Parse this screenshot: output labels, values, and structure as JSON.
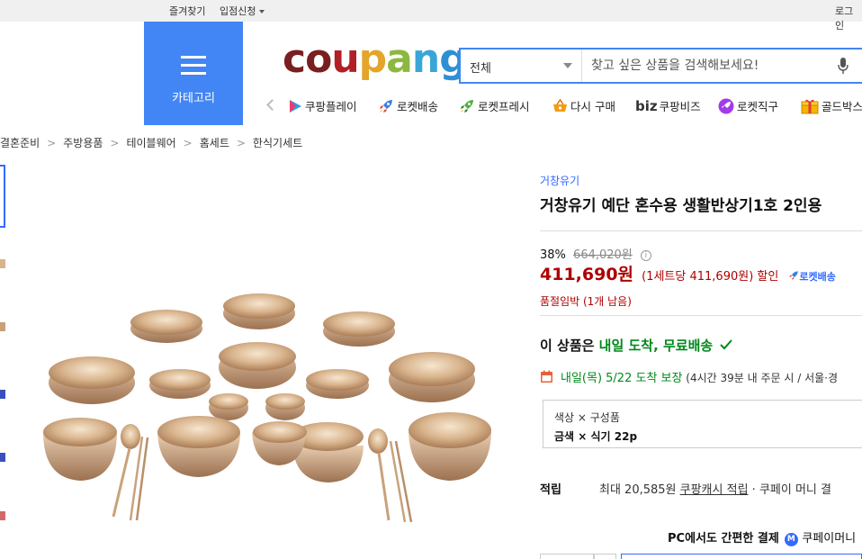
{
  "topbar": {
    "favorites": "즐겨찾기",
    "seller_apply": "입점신청",
    "login": "로그인"
  },
  "category_button": {
    "label": "카테고리"
  },
  "logo": {
    "text": "coupang",
    "colors": [
      "#7a1f1f",
      "#7a1f1f",
      "#b21f24",
      "#e4a52b",
      "#8cb83f",
      "#3aa6d8",
      "#2f8fd3"
    ]
  },
  "search": {
    "category_selected": "전체",
    "placeholder": "찾고 싶은 상품을 검색해보세요!"
  },
  "quick_links": [
    {
      "label": "쿠팡플레이",
      "icon": "play-icon"
    },
    {
      "label": "로켓배송",
      "icon": "rocket-icon"
    },
    {
      "label": "로켓프레시",
      "icon": "rocket-fresh-icon"
    },
    {
      "label": "다시 구매",
      "icon": "basket-icon"
    },
    {
      "label": "쿠팡비즈",
      "prefix": "biz",
      "icon": "biz-icon"
    },
    {
      "label": "로켓직구",
      "icon": "rocket-global-icon"
    },
    {
      "label": "골드박스",
      "icon": "gold-box-icon"
    }
  ],
  "breadcrumb": [
    "결혼준비",
    "주방용품",
    "테이블웨어",
    "홈세트",
    "한식기세트"
  ],
  "product": {
    "brand": "거창유기",
    "title": "거창유기 예단 혼수용 생활반상기1호 2인용",
    "discount_rate": "38%",
    "original_price": "664,020원",
    "price": "411,690원",
    "unit_price": "(1세트당 411,690원) 할인",
    "rocket_badge": "로켓배송",
    "stock_notice": "품절임박 (1개 남음)",
    "delivery_prefix": "이 상품은 ",
    "delivery_highlight": "내일 도착, 무료배송",
    "arrival_date": "내일(목) 5/22 도착 보장",
    "arrival_detail": " (4시간 39분  내 주문 시 / 서울·경",
    "option_label": "색상 × 구성품",
    "option_value": "금색 × 식기 22p",
    "reward_label": "적립",
    "reward_prefix": "최대 20,585원 ",
    "reward_link": "쿠팡캐시 적립",
    "reward_suffix": " · 쿠페이 머니 결",
    "pc_pay_text": "PC에서도 간편한 결제",
    "pc_pay_brand": "쿠페이머니"
  }
}
